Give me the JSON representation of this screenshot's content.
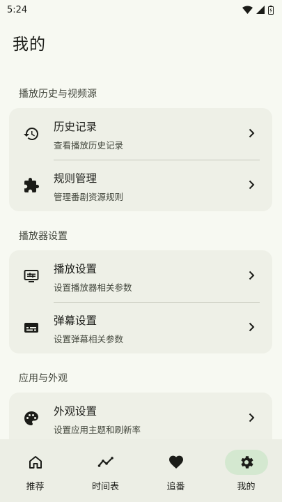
{
  "status_bar": {
    "time": "5:24"
  },
  "header": {
    "title": "我的"
  },
  "sections": [
    {
      "title": "播放历史与视频源",
      "items": [
        {
          "icon": "history-icon",
          "title": "历史记录",
          "subtitle": "查看播放历史记录"
        },
        {
          "icon": "puzzle-icon",
          "title": "规则管理",
          "subtitle": "管理番剧资源规则"
        }
      ]
    },
    {
      "title": "播放器设置",
      "items": [
        {
          "icon": "player-settings-icon",
          "title": "播放设置",
          "subtitle": "设置播放器相关参数"
        },
        {
          "icon": "subtitles-icon",
          "title": "弹幕设置",
          "subtitle": "设置弹幕相关参数"
        }
      ]
    },
    {
      "title": "应用与外观",
      "items": [
        {
          "icon": "palette-icon",
          "title": "外观设置",
          "subtitle": "设置应用主题和刷新率"
        }
      ]
    }
  ],
  "bottom_nav": {
    "items": [
      {
        "label": "推荐",
        "icon": "home-icon",
        "active": false
      },
      {
        "label": "时间表",
        "icon": "timeline-icon",
        "active": false
      },
      {
        "label": "追番",
        "icon": "heart-icon",
        "active": false
      },
      {
        "label": "我的",
        "icon": "gear-icon",
        "active": true
      }
    ]
  },
  "colors": {
    "background": "#f7f9f2",
    "card": "#eef0e7",
    "nav_background": "#eceee5",
    "nav_active_pill": "#d4e8d0",
    "text_primary": "#1b1c18",
    "text_secondary": "#44483e"
  }
}
